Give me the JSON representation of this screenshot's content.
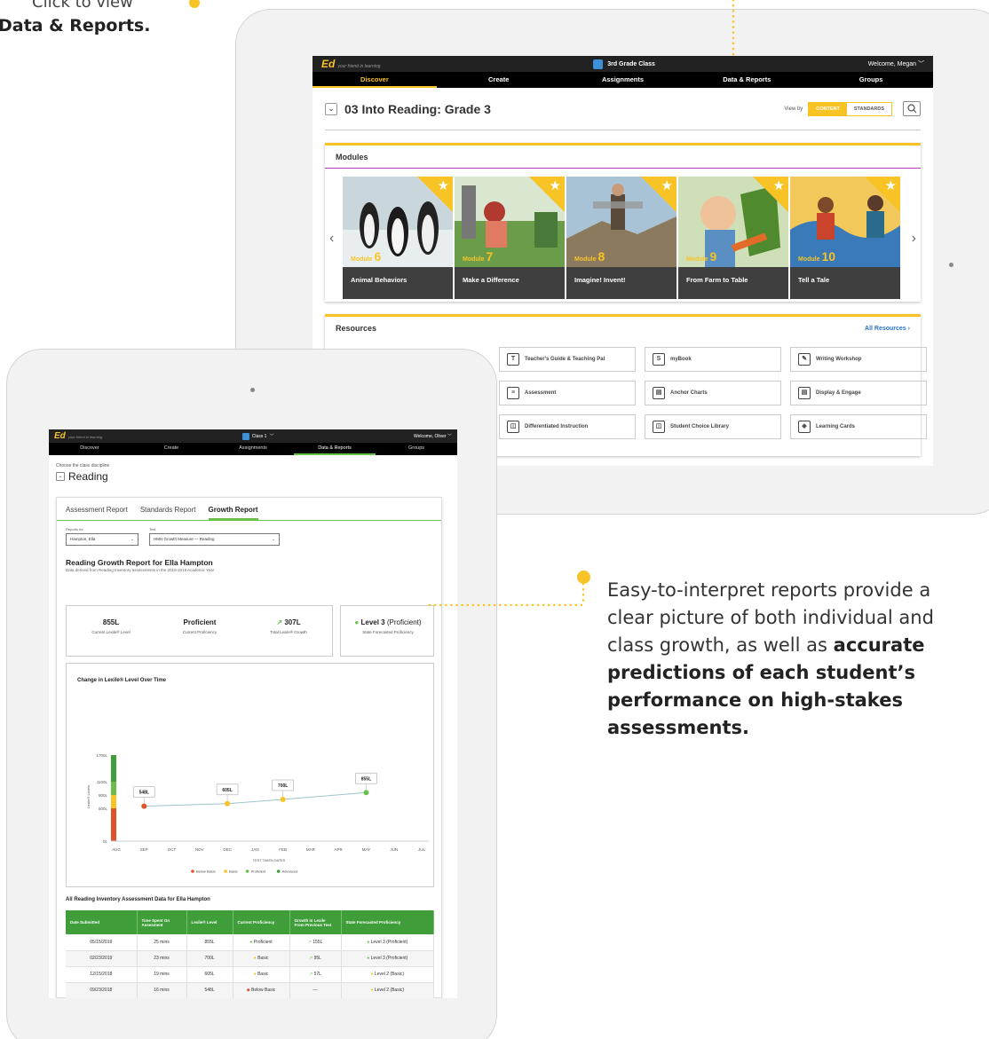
{
  "caption": {
    "line1": "Click to view",
    "line2": "Data & Reports."
  },
  "callout": {
    "text_plain": "Easy-to-interpret reports provide a clear picture of both individual and class growth, as well as",
    "text_bold": "accurate predictions of each student’s performance on high-stakes assessments."
  },
  "colors": {
    "accent": "#f7c325",
    "green": "#3f9e3a",
    "nav_bg": "#000000",
    "link": "#2a74c9"
  },
  "back_app": {
    "logo": "Ed",
    "tagline": "your friend in learning",
    "class_name": "3rd Grade Class",
    "welcome": "Welcome, Megan",
    "nav": [
      "Discover",
      "Create",
      "Assignments",
      "Data & Reports",
      "Groups"
    ],
    "page_title": "03 Into Reading: Grade 3",
    "view_by": "View by",
    "toggle": {
      "content": "CONTENT",
      "standards": "STANDARDS"
    },
    "modules_heading": "Modules",
    "modules": [
      {
        "label": "Module",
        "num": "6",
        "title": "Animal Behaviors"
      },
      {
        "label": "Module",
        "num": "7",
        "title": "Make a Difference"
      },
      {
        "label": "Module",
        "num": "8",
        "title": "Imagine! Invent!"
      },
      {
        "label": "Module",
        "num": "9",
        "title": "From Farm to Table"
      },
      {
        "label": "Module",
        "num": "10",
        "title": "Tell a Tale"
      }
    ],
    "resources_heading": "Resources",
    "all_resources": "All Resources",
    "resources": [
      {
        "label": "Teacher's Guide & Teaching Pal",
        "icon": "T"
      },
      {
        "label": "myBook",
        "icon": "S"
      },
      {
        "label": "Writing Workshop",
        "icon": "✎"
      },
      {
        "label": "Assessment",
        "icon": "≡"
      },
      {
        "label": "Anchor Charts",
        "icon": "▤"
      },
      {
        "label": "Display & Engage",
        "icon": "▤"
      },
      {
        "label": "Differentiated Instruction",
        "icon": "◫"
      },
      {
        "label": "Student Choice Library",
        "icon": "◫"
      },
      {
        "label": "Learning Cards",
        "icon": "◈"
      }
    ]
  },
  "front_app": {
    "logo": "Ed",
    "tagline": "your friend in learning",
    "class_name": "Class 1",
    "welcome": "Welcome, Oliver",
    "nav": [
      "Discover",
      "Create",
      "Assignments",
      "Data & Reports",
      "Groups"
    ],
    "discipline_label": "Choose the class discipline",
    "discipline": "Reading",
    "tabs": [
      "Assessment Report",
      "Standards Report",
      "Growth Report"
    ],
    "reports_for_label": "Reports for",
    "reports_for_value": "Hampton, Ella",
    "test_label": "Test",
    "test_value": "HMH Growth Measure — Reading",
    "report_title": "Reading Growth Report for Ella Hampton",
    "report_sub": "Data derived from Reading Inventory assessments in the 2018-2019 Academic Year",
    "stats": [
      {
        "value": "855L",
        "label": "Current Lexile® Level"
      },
      {
        "value": "Proficient",
        "label": "Current Proficiency"
      },
      {
        "value": "307L",
        "label": "Total Lexile® Growth"
      }
    ],
    "state_stat": {
      "value": "Level 3",
      "value_suffix": "(Proficient)",
      "label": "State Forecasted Proficiency"
    },
    "table_title": "All Reading Inventory Assessment Data for Ella Hampton",
    "table_headers": [
      "Date Submitted",
      "Time Spent On Assesment",
      "Lexile® Level",
      "Current Proficiency",
      "Growth in Lexile From Previous Test",
      "State Forecasted Proficiency"
    ],
    "table_rows": [
      {
        "date": "05/15/2019",
        "time": "25 mins",
        "lexile": "855L",
        "prof": "Proficient",
        "prof_color": "#6abf4b",
        "growth": "155L",
        "state": "Level 3  (Proficient)",
        "state_color": "#6abf4b"
      },
      {
        "date": "02/23/2019",
        "time": "23 mins",
        "lexile": "700L",
        "prof": "Basic",
        "prof_color": "#f7c325",
        "growth": "95L",
        "state": "Level 3  (Proficient)",
        "state_color": "#6abf4b"
      },
      {
        "date": "12/15/2018",
        "time": "19 mins",
        "lexile": "605L",
        "prof": "Basic",
        "prof_color": "#f7c325",
        "growth": "57L",
        "state": "Level 2  (Basic)",
        "state_color": "#f7c325"
      },
      {
        "date": "09/23/2018",
        "time": "16 mins",
        "lexile": "548L",
        "prof": "Below Basic",
        "prof_color": "#e0522a",
        "growth": "—",
        "state": "Level 2  (Basic)",
        "state_color": "#f7c325"
      }
    ]
  },
  "chart_data": {
    "type": "line",
    "title": "Change in Lexile® Level Over Time",
    "xlabel": "TEST TAKEN DATES",
    "ylabel": "Lexile® Levels",
    "categories": [
      "AUG",
      "SEP",
      "OCT",
      "NOV",
      "DEC",
      "JAN",
      "FEB",
      "MAR",
      "APR",
      "MAY",
      "JUN",
      "JUL"
    ],
    "y_ticks": [
      "0L",
      "500L",
      "800L",
      "1100L",
      "1700L"
    ],
    "y_tick_values": [
      0,
      500,
      800,
      1100,
      1700
    ],
    "series": [
      {
        "points": [
          {
            "x": "SEP",
            "y": 548,
            "label": "548L",
            "color": "#e0522a"
          },
          {
            "x": "DEC",
            "y": 605,
            "label": "605L",
            "color": "#f7c325"
          },
          {
            "x": "FEB",
            "y": 700,
            "label": "700L",
            "color": "#f7c325"
          },
          {
            "x": "MAY",
            "y": 855,
            "label": "855L",
            "color": "#6abf4b"
          }
        ]
      }
    ],
    "bands": [
      {
        "name": "Below Basic",
        "from": 0,
        "to": 500,
        "color": "#e0522a"
      },
      {
        "name": "Basic",
        "from": 500,
        "to": 800,
        "color": "#f7c325"
      },
      {
        "name": "Proficient",
        "from": 800,
        "to": 1100,
        "color": "#6abf4b"
      },
      {
        "name": "Advanced",
        "from": 1100,
        "to": 1700,
        "color": "#3f9e3a"
      }
    ],
    "legend": [
      "Below Basic",
      "Basic",
      "Proficient",
      "Advanced"
    ],
    "legend_position": "bottom",
    "ylim": [
      0,
      1700
    ],
    "grid": false
  }
}
